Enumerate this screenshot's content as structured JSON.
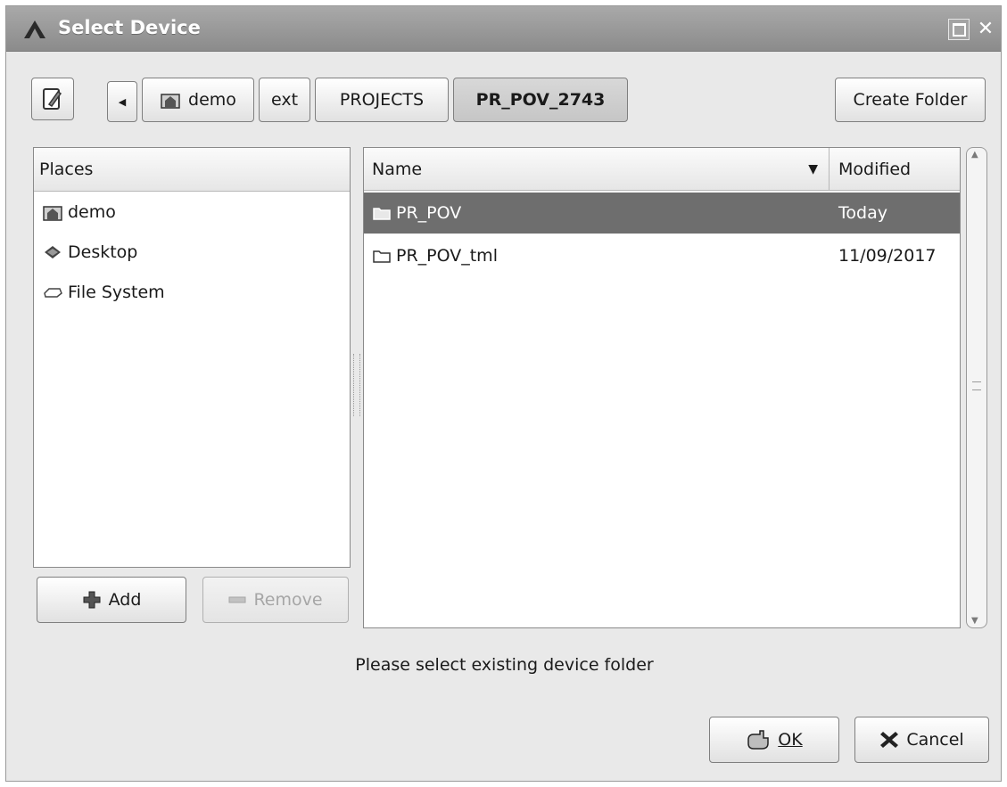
{
  "window": {
    "title": "Select Device"
  },
  "toolbar": {
    "breadcrumbs": [
      "demo",
      "ext",
      "PROJECTS",
      "PR_POV_2743"
    ],
    "create_folder_label": "Create Folder"
  },
  "places": {
    "header": "Places",
    "items": [
      {
        "label": "demo",
        "icon": "home-folder-icon"
      },
      {
        "label": "Desktop",
        "icon": "desktop-icon"
      },
      {
        "label": "File System",
        "icon": "drive-icon"
      }
    ],
    "add_label": "Add",
    "remove_label": "Remove"
  },
  "files": {
    "columns": {
      "name": "Name",
      "modified": "Modified"
    },
    "rows": [
      {
        "name": "PR_POV",
        "modified": "Today",
        "selected": true
      },
      {
        "name": "PR_POV_tml",
        "modified": "11/09/2017",
        "selected": false
      }
    ]
  },
  "status": "Please select existing device folder",
  "actions": {
    "ok_label": "OK",
    "cancel_label": "Cancel"
  },
  "colors": {
    "titlebar": "#8b8b8b",
    "selection": "#6e6e6e",
    "dialog_bg": "#e9e9e9"
  }
}
